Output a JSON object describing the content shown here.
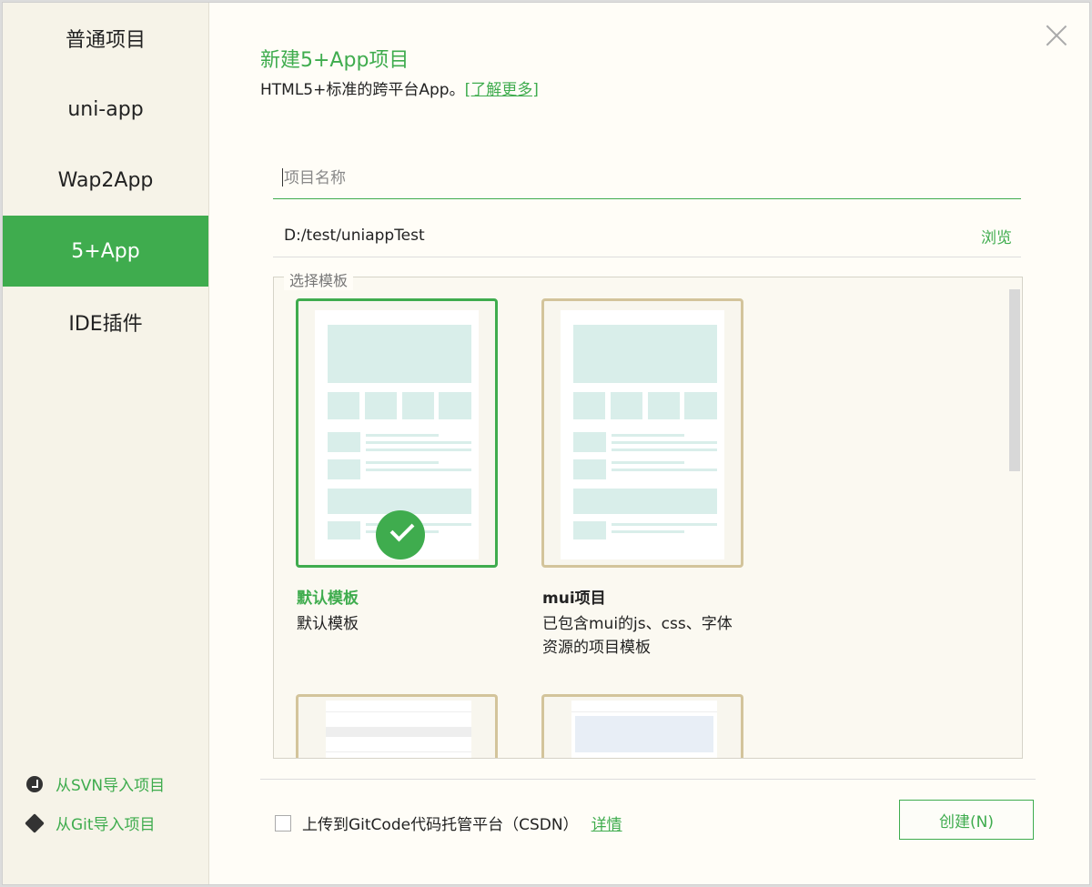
{
  "sidebar": {
    "items": [
      {
        "label": "普通项目",
        "active": false
      },
      {
        "label": "uni-app",
        "active": false
      },
      {
        "label": "Wap2App",
        "active": false
      },
      {
        "label": "5+App",
        "active": true
      },
      {
        "label": "IDE插件",
        "active": false
      }
    ],
    "import_svn": "从SVN导入项目",
    "import_git": "从Git导入项目"
  },
  "header": {
    "title": "新建5+App项目",
    "subtitle": "HTML5+标准的跨平台App。",
    "learn_more": "[了解更多]"
  },
  "form": {
    "name_placeholder": "项目名称",
    "name_value": "",
    "path": "D:/test/uniappTest",
    "browse": "浏览"
  },
  "templates": {
    "legend": "选择模板",
    "items": [
      {
        "title": "默认模板",
        "desc": "默认模板",
        "selected": true
      },
      {
        "title": "mui项目",
        "desc_line1": "已包含mui的js、css、字体",
        "desc_line2": "资源的项目模板",
        "selected": false
      }
    ]
  },
  "footer": {
    "upload_label": "上传到GitCode代码托管平台（CSDN）",
    "details": "详情",
    "create": "创建(N)"
  },
  "colors": {
    "accent": "#3fac4e",
    "card_border": "#d3c49b"
  }
}
